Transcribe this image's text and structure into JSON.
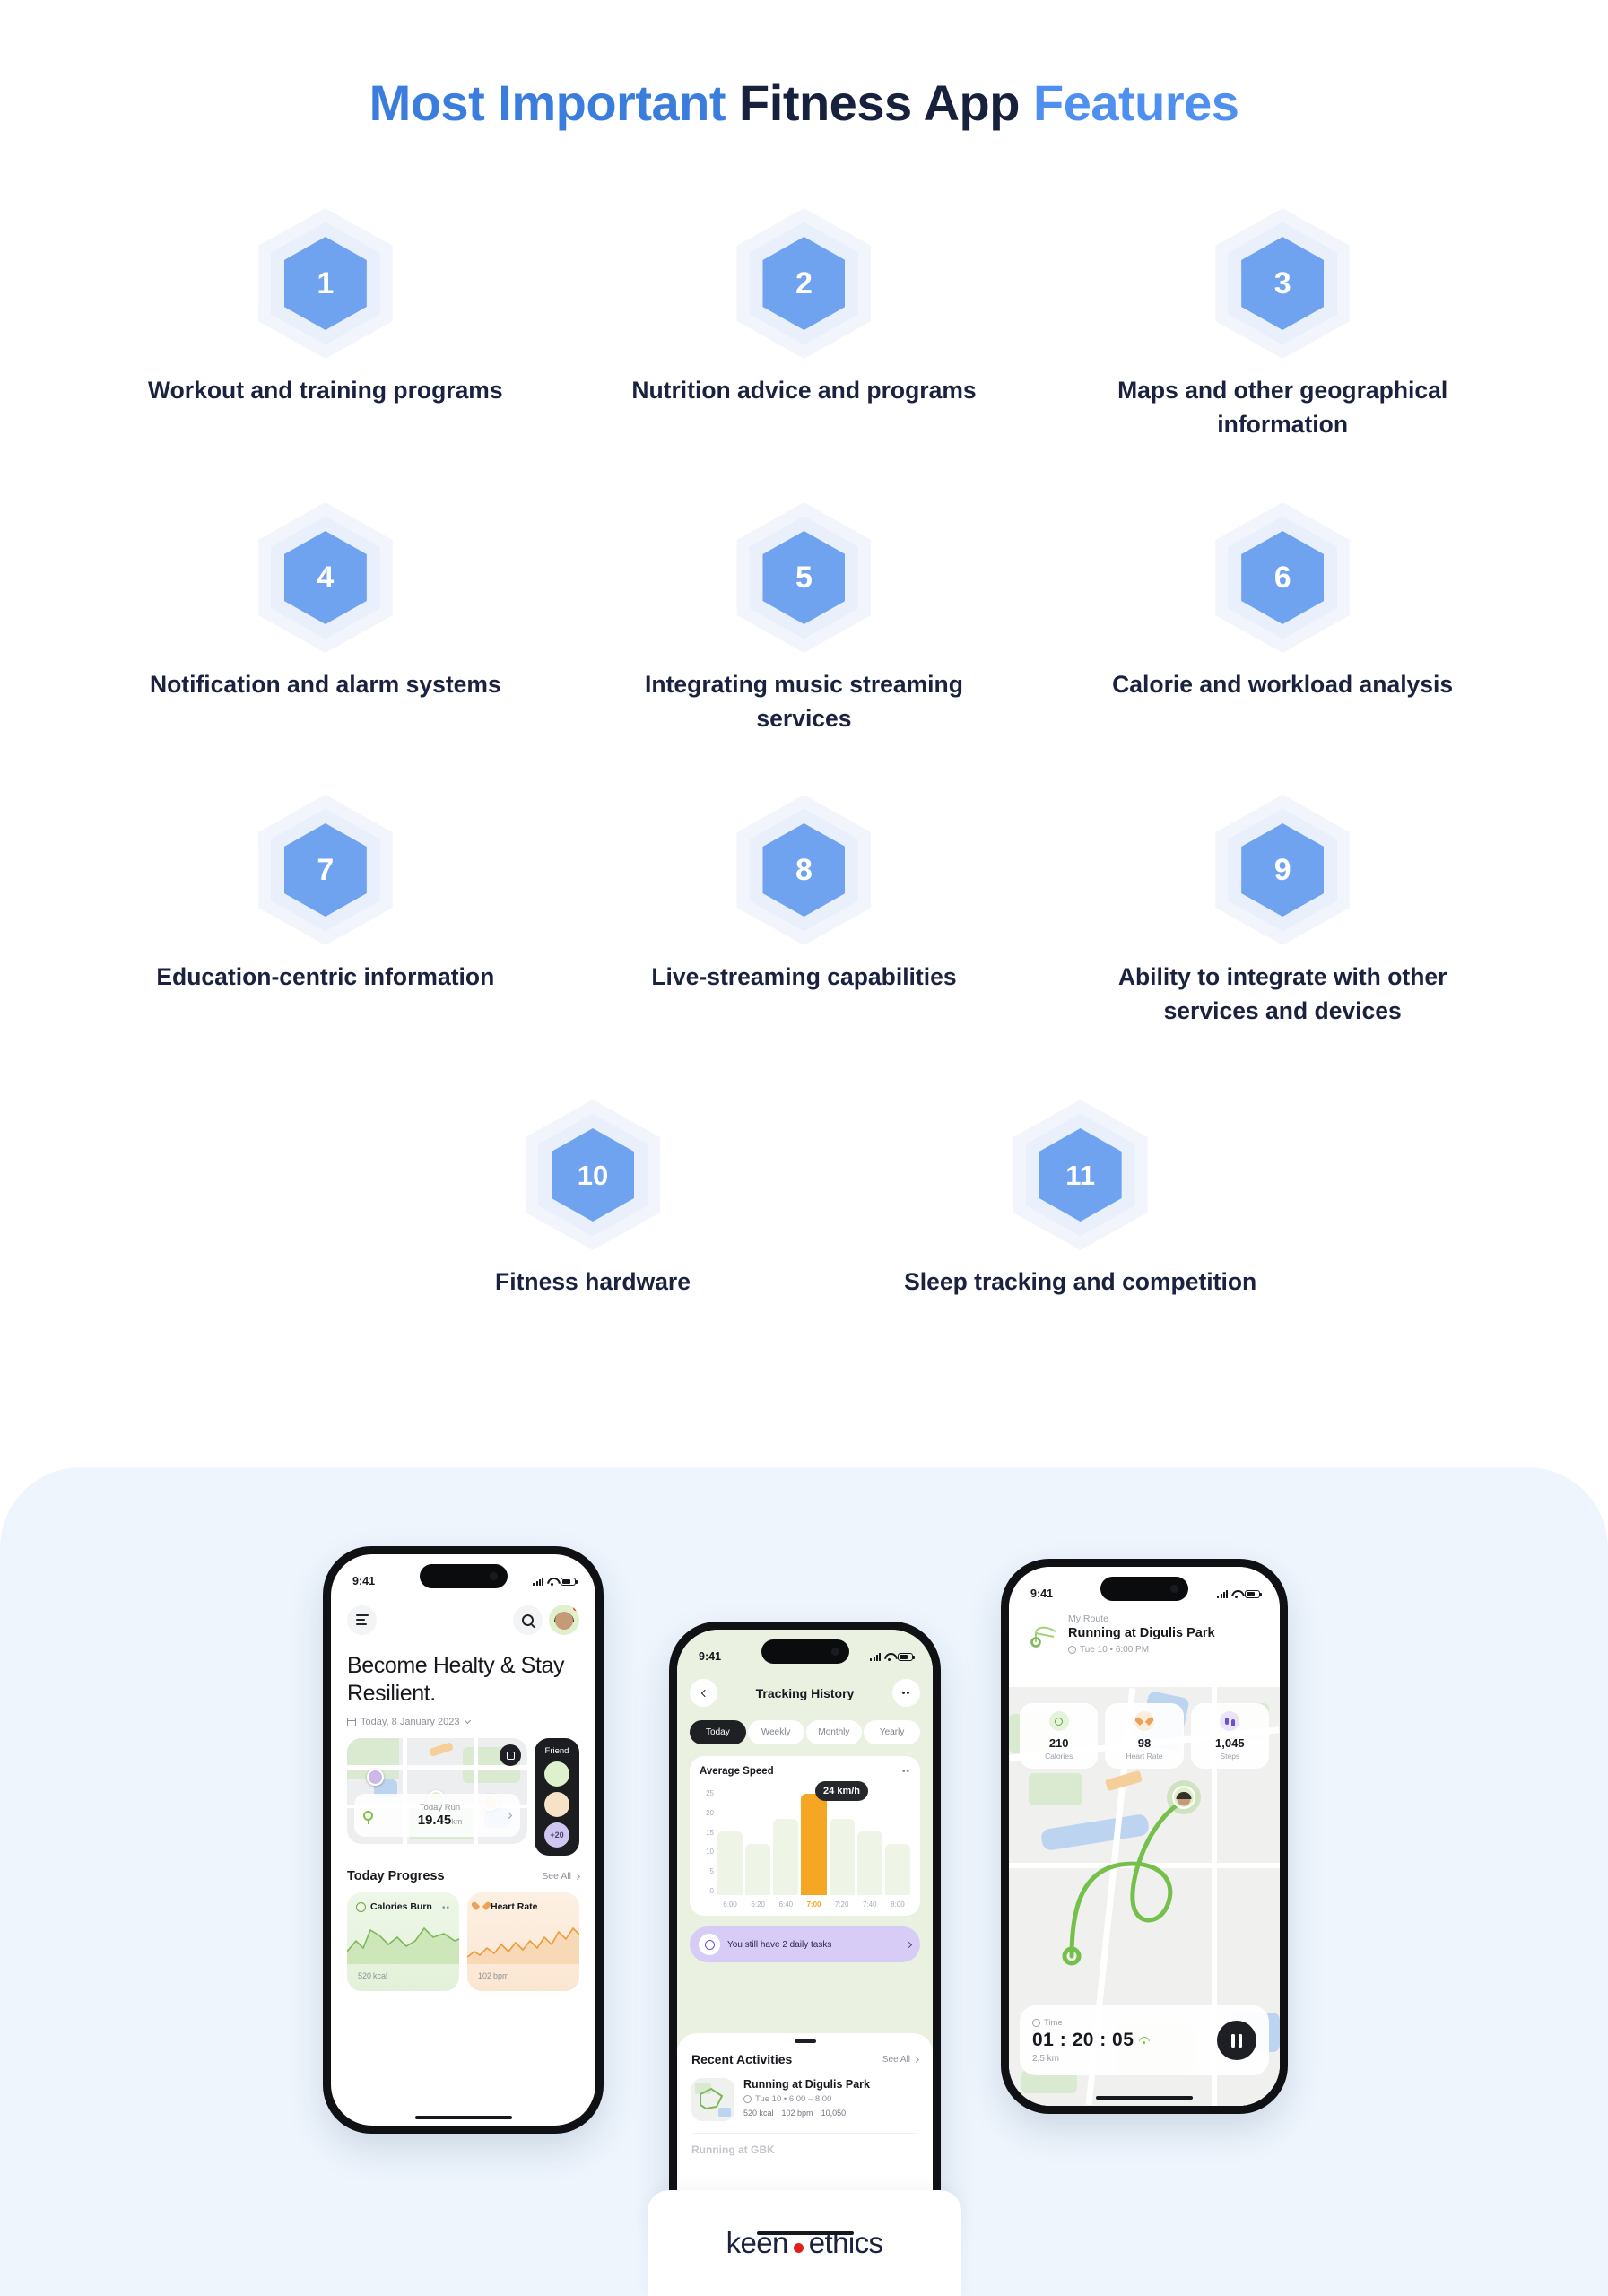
{
  "title": {
    "part1": "Most Important",
    "part2": "Fitness App",
    "part3": "Features"
  },
  "features": [
    {
      "number": "1",
      "label": "Workout and training programs"
    },
    {
      "number": "2",
      "label": "Nutrition advice and programs"
    },
    {
      "number": "3",
      "label": "Maps and other geographical information"
    },
    {
      "number": "4",
      "label": "Notification and alarm systems"
    },
    {
      "number": "5",
      "label": "Integrating music streaming services"
    },
    {
      "number": "6",
      "label": "Calorie and workload analysis"
    },
    {
      "number": "7",
      "label": "Education-centric information"
    },
    {
      "number": "8",
      "label": "Live-streaming capabilities"
    },
    {
      "number": "9",
      "label": "Ability to integrate with other services and devices"
    },
    {
      "number": "10",
      "label": "Fitness hardware"
    },
    {
      "number": "11",
      "label": "Sleep tracking and competition"
    }
  ],
  "phone1": {
    "status_time": "9:41",
    "heading": "Become Healty & Stay Resilient.",
    "date": "Today, 8 January 2023",
    "run_label": "Today Run",
    "run_value": "19.45",
    "run_unit": "km",
    "friend_label": "Friend",
    "friend_more": "+20",
    "progress_title": "Today Progress",
    "see_all": "See All",
    "card_calories_title": "Calories Burn",
    "card_calories_value": "520",
    "card_calories_unit": "kcal",
    "card_heart_title": "Heart Rate",
    "card_heart_value": "102",
    "card_heart_unit": "bpm"
  },
  "phone2": {
    "status_time": "9:41",
    "title": "Tracking History",
    "tabs": [
      "Today",
      "Weekly",
      "Monthly",
      "Yearly"
    ],
    "chart_title": "Average Speed",
    "tooltip_value": "24",
    "tooltip_unit": "km/h",
    "task_text": "You still have 2 daily tasks",
    "recent_title": "Recent Activities",
    "see_all": "See All",
    "activity_title": "Running at Digulis Park",
    "activity_time": "Tue 10 • 6:00 – 8:00",
    "activity_kcal": "520 kcal",
    "activity_bpm": "102 bpm",
    "activity_steps": "10,050",
    "activity_next": "Running at GBK"
  },
  "phone3": {
    "status_time": "9:41",
    "subtitle": "My Route",
    "title": "Running at Digulis Park",
    "time": "Tue 10 • 6:00 PM",
    "stats": [
      {
        "value": "210",
        "label": "Calories"
      },
      {
        "value": "98",
        "label": "Heart Rate"
      },
      {
        "value": "1,045",
        "label": "Steps"
      }
    ],
    "timer_label": "Time",
    "timer_value": "01 : 20 : 05",
    "distance": "2,5 km"
  },
  "logo": {
    "part1": "keen",
    "part2": "ethics"
  },
  "chart_data": {
    "type": "bar",
    "title": "Average Speed",
    "categories": [
      "6:00",
      "6:20",
      "6:40",
      "7:00",
      "7:20",
      "7:40",
      "8:00"
    ],
    "values": [
      15,
      12,
      18,
      24,
      18,
      15,
      12
    ],
    "highlight_index": 3,
    "highlight_label": "24 km/h",
    "ylabel": "",
    "xlabel": "",
    "ylim": [
      0,
      25
    ],
    "yticks": [
      25,
      20,
      15,
      10,
      5,
      0
    ],
    "grid": true,
    "legend": false,
    "accent_color": "#f5a623",
    "bar_color": "#eef5e6"
  },
  "colors": {
    "accent_blue": "#6fa3f0",
    "title_blue": "#3b7ddd",
    "navy": "#1b2240",
    "panel_bg": "#eef5fd",
    "logo_red": "#e0201b"
  }
}
